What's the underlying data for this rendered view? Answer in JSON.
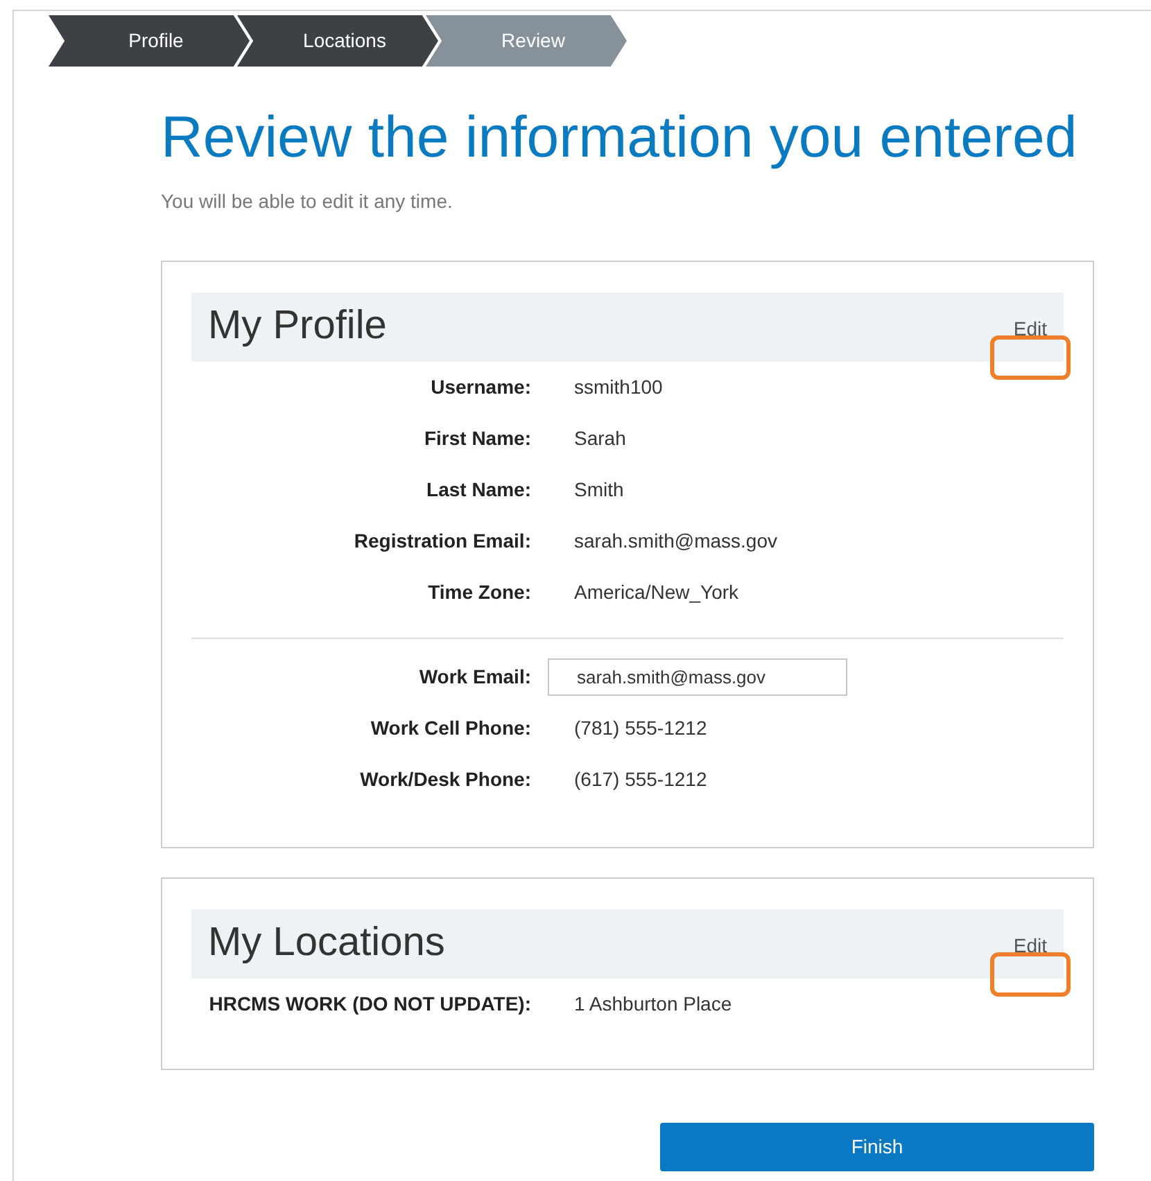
{
  "steps": [
    {
      "label": "Profile",
      "selected": false
    },
    {
      "label": "Locations",
      "selected": false
    },
    {
      "label": "Review",
      "selected": true
    }
  ],
  "heading": "Review the information you entered",
  "subtitle": "You will be able to edit it any time.",
  "sections": [
    {
      "title": "My Profile",
      "edit": "Edit",
      "highlighted": true,
      "groups": [
        [
          {
            "label": "Username:",
            "value": "ssmith100",
            "kind": "text"
          },
          {
            "label": "First Name:",
            "value": "Sarah",
            "kind": "text"
          },
          {
            "label": "Last Name:",
            "value": "Smith",
            "kind": "text"
          },
          {
            "label": "Registration Email:",
            "value": "sarah.smith@mass.gov",
            "kind": "text"
          },
          {
            "label": "Time Zone:",
            "value": "America/New_York",
            "kind": "text"
          }
        ],
        [
          {
            "label": "Work Email:",
            "value": "sarah.smith@mass.gov",
            "kind": "input"
          },
          {
            "label": "Work Cell Phone:",
            "value": "(781) 555-1212",
            "kind": "text"
          },
          {
            "label": "Work/Desk Phone:",
            "value": "(617) 555-1212",
            "kind": "text"
          }
        ]
      ]
    },
    {
      "title": "My Locations",
      "edit": "Edit",
      "highlighted": true,
      "groups": [
        [
          {
            "label": "HRCMS WORK (DO NOT UPDATE):",
            "value": "1 Ashburton Place",
            "kind": "text"
          }
        ]
      ]
    }
  ],
  "finish": "Finish"
}
